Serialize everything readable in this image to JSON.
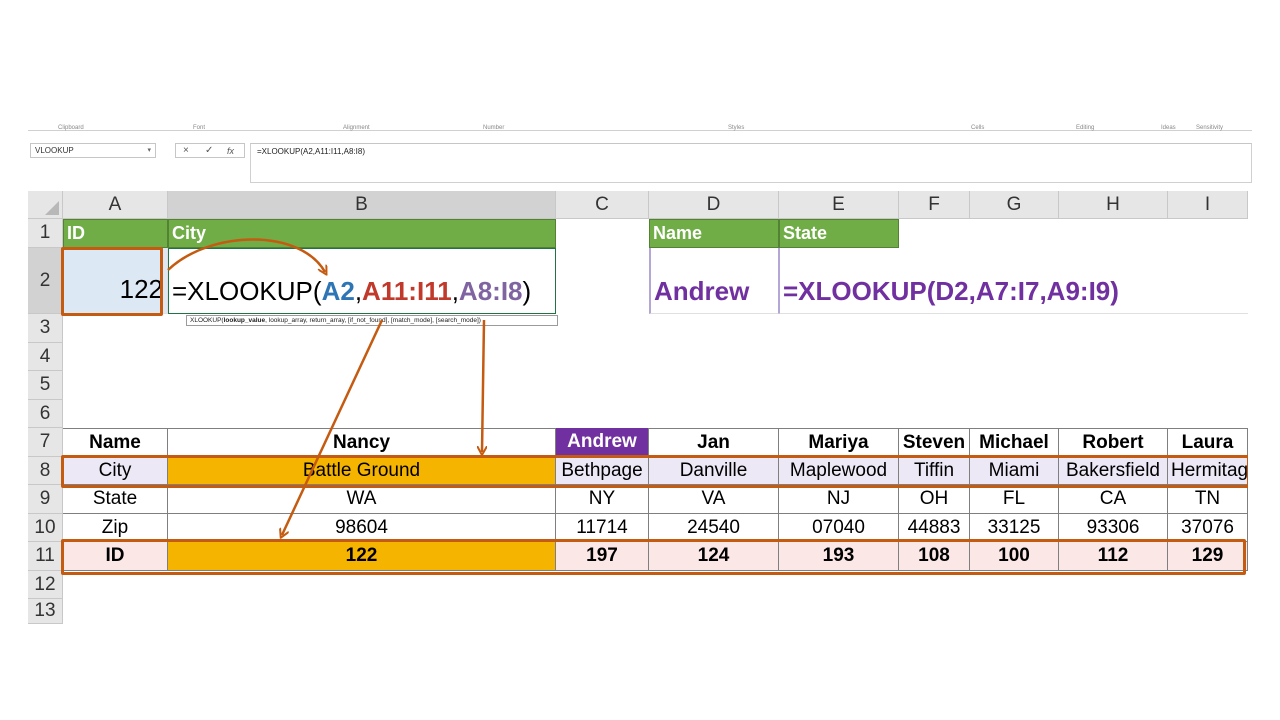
{
  "ribbon": {
    "groups": [
      "Clipboard",
      "Font",
      "Alignment",
      "Number",
      "Styles",
      "Cells",
      "Editing",
      "Ideas",
      "Sensitivity"
    ]
  },
  "formula_bar": {
    "name_box": "VLOOKUP",
    "cancel_icon": "×",
    "enter_icon": "✓",
    "fx_label": "fx",
    "formula": "=XLOOKUP(A2,A11:I11,A8:I8)"
  },
  "columns": [
    "A",
    "B",
    "C",
    "D",
    "E",
    "F",
    "G",
    "H",
    "I"
  ],
  "rows": [
    "1",
    "2",
    "3",
    "4",
    "5",
    "6",
    "7",
    "8",
    "9",
    "10",
    "11",
    "12",
    "13"
  ],
  "headers": {
    "id": "ID",
    "city": "City",
    "name": "Name",
    "state": "State"
  },
  "row2": {
    "id_value": "122",
    "formula_prefix": "=XLOOKUP(",
    "arg1": "A2",
    "arg2": "A11:I11",
    "arg3": "A8:I8",
    "sep": ",",
    "close": ")",
    "tooltip": "XLOOKUP(lookup_value, lookup_array, return_array, [if_not_found], [match_mode], [search_mode])",
    "tooltip_bold": "lookup_value",
    "name_value": "Andrew",
    "state_formula": "=XLOOKUP(D2,A7:I7,A9:I9)"
  },
  "table": {
    "labels": [
      "Name",
      "City",
      "State",
      "Zip",
      "ID"
    ],
    "names": [
      "Nancy",
      "Andrew",
      "Jan",
      "Mariya",
      "Steven",
      "Michael",
      "Robert",
      "Laura"
    ],
    "cities": [
      "Battle Ground",
      "Bethpage",
      "Danville",
      "Maplewood",
      "Tiffin",
      "Miami",
      "Bakersfield",
      "Hermitag"
    ],
    "states": [
      "WA",
      "NY",
      "VA",
      "NJ",
      "OH",
      "FL",
      "CA",
      "TN"
    ],
    "zips": [
      "98604",
      "11714",
      "24540",
      "07040",
      "44883",
      "33125",
      "93306",
      "37076"
    ],
    "ids": [
      "122",
      "197",
      "124",
      "193",
      "108",
      "100",
      "112",
      "129"
    ]
  },
  "colors": {
    "header_green": "#70ad47",
    "highlight_orange": "#f4b400",
    "callout_orange": "#c55a11",
    "arg_blue": "#2e75b6",
    "arg_red": "#c0392b",
    "arg_purple": "#8064a2",
    "purple_text": "#7030a0",
    "row_tint_lavender": "#ede8f5",
    "row_tint_pink": "#fbe7e6",
    "selected_cell": "#dde8f5"
  }
}
